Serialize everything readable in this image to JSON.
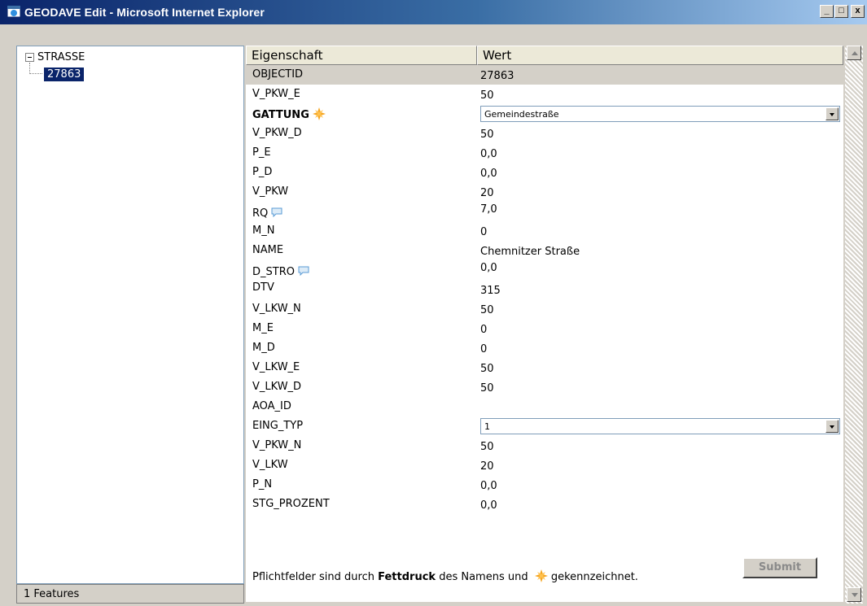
{
  "window": {
    "title": "GEODAVE Edit - Microsoft Internet Explorer",
    "minimize": "_",
    "maximize": "□",
    "close": "x"
  },
  "tree": {
    "root_label": "STRASSE",
    "child_label": "27863"
  },
  "status": {
    "text": "1 Features"
  },
  "table": {
    "header_property": "Eigenschaft",
    "header_value": "Wert",
    "rows": [
      {
        "name": "OBJECTID",
        "value": "27863"
      },
      {
        "name": "V_PKW_E",
        "value": "50"
      },
      {
        "name": "GATTUNG",
        "value": "Gemeindestraße"
      },
      {
        "name": "V_PKW_D",
        "value": "50"
      },
      {
        "name": "P_E",
        "value": "0,0"
      },
      {
        "name": "P_D",
        "value": "0,0"
      },
      {
        "name": "V_PKW",
        "value": "20"
      },
      {
        "name": "RQ",
        "value": "7,0"
      },
      {
        "name": "M_N",
        "value": "0"
      },
      {
        "name": "NAME",
        "value": "Chemnitzer Straße"
      },
      {
        "name": "D_STRO",
        "value": "0,0"
      },
      {
        "name": "DTV",
        "value": "315"
      },
      {
        "name": "V_LKW_N",
        "value": "50"
      },
      {
        "name": "M_E",
        "value": "0"
      },
      {
        "name": "M_D",
        "value": "0"
      },
      {
        "name": "V_LKW_E",
        "value": "50"
      },
      {
        "name": "V_LKW_D",
        "value": "50"
      },
      {
        "name": "AOA_ID",
        "value": ""
      },
      {
        "name": "EING_TYP",
        "value": "1"
      },
      {
        "name": "V_PKW_N",
        "value": "50"
      },
      {
        "name": "V_LKW",
        "value": "20"
      },
      {
        "name": "P_N",
        "value": "0,0"
      },
      {
        "name": "STG_PROZENT",
        "value": "0,0"
      }
    ]
  },
  "footer": {
    "note_part1": "Pflichtfelder sind durch ",
    "note_bold": "Fettdruck",
    "note_part2": " des Namens und ",
    "note_part3": " gekennzeichnet.",
    "submit_label": "Submit"
  },
  "colors": {
    "selection": "#0a246a",
    "required_star": "#f5a623",
    "comment_icon": "#5a9bd5"
  },
  "icons": {
    "title": "ie-window-icon",
    "required": "required-star-icon",
    "comment": "comment-bubble-icon"
  }
}
